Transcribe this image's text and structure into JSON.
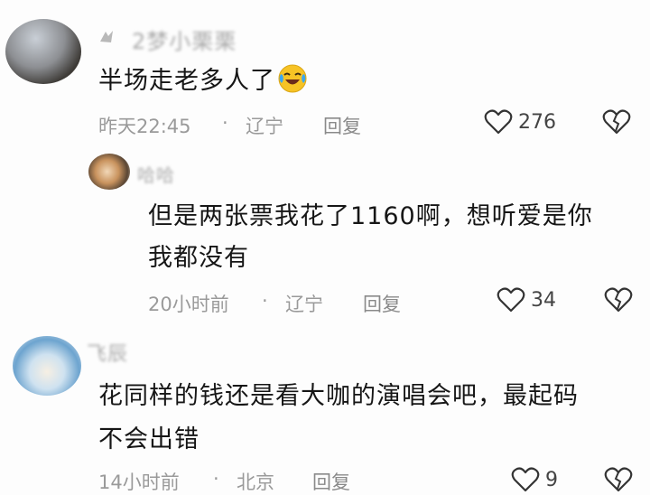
{
  "comments": [
    {
      "username": "2梦小栗栗",
      "text": "半场走老多人了",
      "emoji": "laughing-crying-emoji",
      "time": "昨天22:45",
      "location": "辽宁",
      "reply_label": "回复",
      "likes": "276"
    },
    {
      "username": "哈哈",
      "text_line1": "但是两张票我花了1160啊，想听爱是你",
      "text_line2": "我都没有",
      "time": "20小时前",
      "location": "辽宁",
      "reply_label": "回复",
      "likes": "34"
    },
    {
      "username": "飞辰",
      "text_line1": "花同样的钱还是看大咖的演唱会吧，最起码",
      "text_line2": "不会出错",
      "time": "14小时前",
      "location": "北京",
      "reply_label": "回复",
      "likes": "9"
    }
  ],
  "separator": "·",
  "icons": {
    "like": "heart-outline-icon",
    "dislike": "broken-heart-icon",
    "verify": "verified-badge-icon"
  },
  "colors": {
    "text": "#161616",
    "meta": "#9a9a9a",
    "emoji_face": "#f7c325",
    "emoji_tear": "#3ba6f0"
  }
}
